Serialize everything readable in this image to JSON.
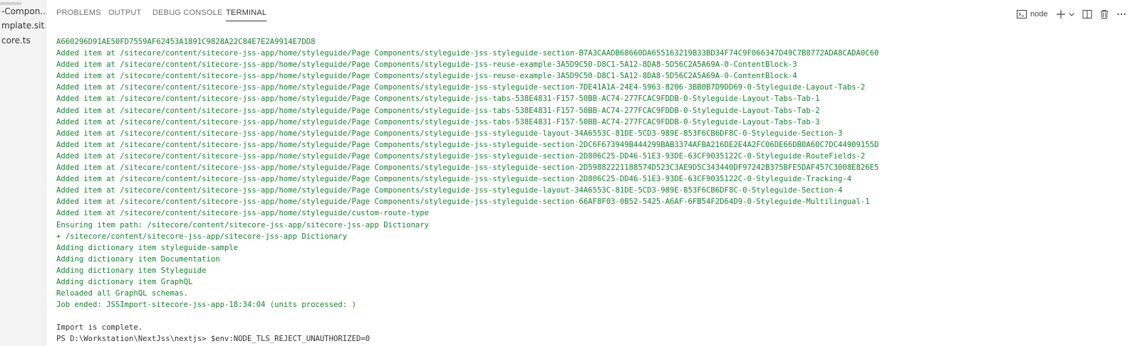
{
  "explorer": {
    "files": [
      "-Compon...",
      "mplate.sit...",
      "core.ts"
    ]
  },
  "tabs": [
    {
      "label": "PROBLEMS",
      "active": false
    },
    {
      "label": "OUTPUT",
      "active": false
    },
    {
      "label": "DEBUG CONSOLE",
      "active": false
    },
    {
      "label": "TERMINAL",
      "active": true
    }
  ],
  "toolbar": {
    "terminal_name": "node",
    "icons": [
      "terminal-icon",
      "plus-icon",
      "chevron-down-icon",
      "split-icon",
      "trash-icon",
      "ellipsis-icon"
    ]
  },
  "colors": {
    "output_green": "#14872f",
    "default_text": "#333333"
  },
  "terminal": {
    "lines": [
      {
        "text": "A660296D91AE50FD7559AF62453A1891C9828A22C84E7E2A9914E7DD8",
        "color": "green"
      },
      {
        "text": "Added item at /sitecore/content/sitecore-jss-app/home/styleguide/Page Components/styleguide-jss-styleguide-section-B7A3CAADB68660DA655163219B33BD34F74C9F066347D49C7B8772ADA8CADA0C60",
        "color": "green"
      },
      {
        "text": "Added item at /sitecore/content/sitecore-jss-app/home/styleguide/Page Components/styleguide-jss-reuse-example-3A5D9C50-D8C1-5A12-8DA8-5D56C2A5A69A-0-ContentBlock-3",
        "color": "green"
      },
      {
        "text": "Added item at /sitecore/content/sitecore-jss-app/home/styleguide/Page Components/styleguide-jss-reuse-example-3A5D9C50-D8C1-5A12-8DA8-5D56C2A5A69A-0-ContentBlock-4",
        "color": "green"
      },
      {
        "text": "Added item at /sitecore/content/sitecore-jss-app/home/styleguide/Page Components/styleguide-jss-styleguide-section-7DE41A1A-24E4-5963-8206-3BB0B7D9DD69-0-Styleguide-Layout-Tabs-2",
        "color": "green"
      },
      {
        "text": "Added item at /sitecore/content/sitecore-jss-app/home/styleguide/Page Components/styleguide-jss-tabs-538E4831-F157-50BB-AC74-277FCAC9FDDB-0-Styleguide-Layout-Tabs-Tab-1",
        "color": "green"
      },
      {
        "text": "Added item at /sitecore/content/sitecore-jss-app/home/styleguide/Page Components/styleguide-jss-tabs-538E4831-F157-50BB-AC74-277FCAC9FDDB-0-Styleguide-Layout-Tabs-Tab-2",
        "color": "green"
      },
      {
        "text": "Added item at /sitecore/content/sitecore-jss-app/home/styleguide/Page Components/styleguide-jss-tabs-538E4831-F157-50BB-AC74-277FCAC9FDDB-0-Styleguide-Layout-Tabs-Tab-3",
        "color": "green"
      },
      {
        "text": "Added item at /sitecore/content/sitecore-jss-app/home/styleguide/Page Components/styleguide-jss-styleguide-layout-34A6553C-81DE-5CD3-989E-853F6CB6DF8C-0-Styleguide-Section-3",
        "color": "green"
      },
      {
        "text": "Added item at /sitecore/content/sitecore-jss-app/home/styleguide/Page Components/styleguide-jss-styleguide-section-2DC6F673949B444299BAB3374AFBA216DE2E4A2FC06DE66DB0A60C7DC44909155D",
        "color": "green"
      },
      {
        "text": "Added item at /sitecore/content/sitecore-jss-app/home/styleguide/Page Components/styleguide-jss-styleguide-section-2D806C25-DD46-51E3-93DE-63CF9035122C-0-Styleguide-RouteFields-2",
        "color": "green"
      },
      {
        "text": "Added item at /sitecore/content/sitecore-jss-app/home/styleguide/Page Components/styleguide-jss-styleguide-section-2D59882221188574D523C3AE9D5C343440DF97242B375BFE5DAF457C3008E826E5",
        "color": "green"
      },
      {
        "text": "Added item at /sitecore/content/sitecore-jss-app/home/styleguide/Page Components/styleguide-jss-styleguide-section-2D806C25-DD46-51E3-93DE-63CF9035122C-0-Styleguide-Tracking-4",
        "color": "green"
      },
      {
        "text": "Added item at /sitecore/content/sitecore-jss-app/home/styleguide/Page Components/styleguide-jss-styleguide-layout-34A6553C-81DE-5CD3-989E-853F6CB6DF8C-0-Styleguide-Section-4",
        "color": "green"
      },
      {
        "text": "Added item at /sitecore/content/sitecore-jss-app/home/styleguide/Page Components/styleguide-jss-styleguide-section-66AF8F03-0B52-5425-A6AF-6FB54F2D64D9-0-Styleguide-Multilingual-1",
        "color": "green"
      },
      {
        "text": "Added item at /sitecore/content/sitecore-jss-app/home/styleguide/custom-route-type",
        "color": "green"
      },
      {
        "text": "Ensuring item path: /sitecore/content/sitecore-jss-app/sitecore-jss-app Dictionary",
        "color": "green"
      },
      {
        "text": "+ /sitecore/content/sitecore-jss-app/sitecore-jss-app Dictionary",
        "color": "green"
      },
      {
        "text": "Adding dictionary item styleguide-sample",
        "color": "green"
      },
      {
        "text": "Adding dictionary item Documentation",
        "color": "green"
      },
      {
        "text": "Adding dictionary item Styleguide",
        "color": "green"
      },
      {
        "text": "Adding dictionary item GraphQL",
        "color": "green"
      },
      {
        "text": "Reloaded all GraphQL schemas.",
        "color": "green"
      },
      {
        "text": "Job ended: JSSImport-sitecore-jss-app-18:34:04 (units processed: )",
        "color": "green"
      },
      {
        "text": "",
        "color": "default"
      },
      {
        "text": "Import is complete.",
        "color": "default"
      },
      {
        "text": "PS D:\\Workstation\\NextJss\\nextjs> $env:NODE_TLS_REJECT_UNAUTHORIZED=0",
        "color": "default"
      }
    ]
  }
}
